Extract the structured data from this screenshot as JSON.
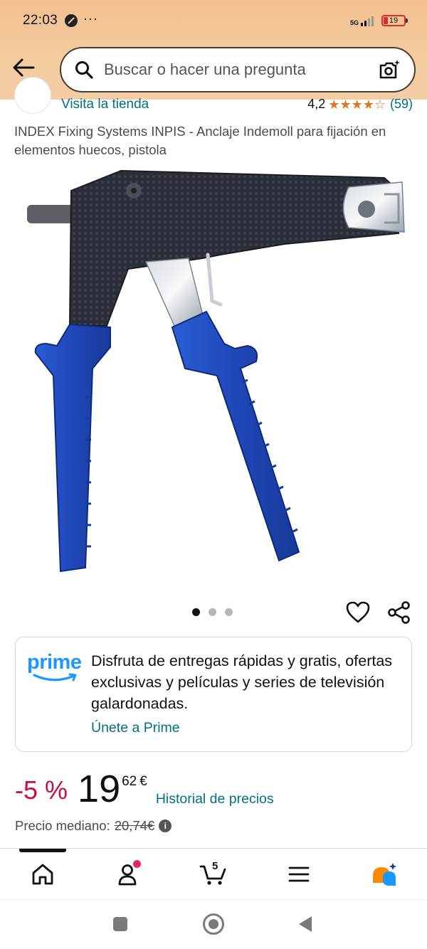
{
  "status_bar": {
    "time": "22:03",
    "overflow": "···",
    "network": "5G",
    "battery": "19"
  },
  "header": {
    "search_placeholder": "Buscar o hacer una pregunta"
  },
  "store": {
    "link_label": "Visita la tienda",
    "rating_value": "4,2",
    "rating_count": "(59)",
    "stars": 4.2
  },
  "product": {
    "title": "INDEX Fixing Systems INPIS - Anclaje Indemoll para fijación en elementos huecos, pistola",
    "image_count": 3,
    "image_index": 1
  },
  "prime": {
    "logo_text": "prime",
    "message": "Disfruta de entregas rápidas y gratis, ofertas exclusivas y películas y series de televisión galardonadas.",
    "link_label": "Únete a Prime"
  },
  "price": {
    "discount": "-5 %",
    "whole": "19",
    "fraction": "62",
    "currency": "€",
    "history_label": "Historial de precios",
    "median_label": "Precio mediano:",
    "median_value": "20,74€",
    "info_symbol": "i"
  },
  "bottom_nav": {
    "items": [
      "home-icon",
      "account-icon",
      "cart-icon",
      "menu-icon",
      "rufus-icon"
    ],
    "cart_count": "5"
  },
  "colors": {
    "accent_link": "#007185",
    "discount_red": "#cc0c39",
    "star_orange": "#de7921",
    "prime_blue": "#1a98ff",
    "handle_blue": "#1f47b8"
  }
}
